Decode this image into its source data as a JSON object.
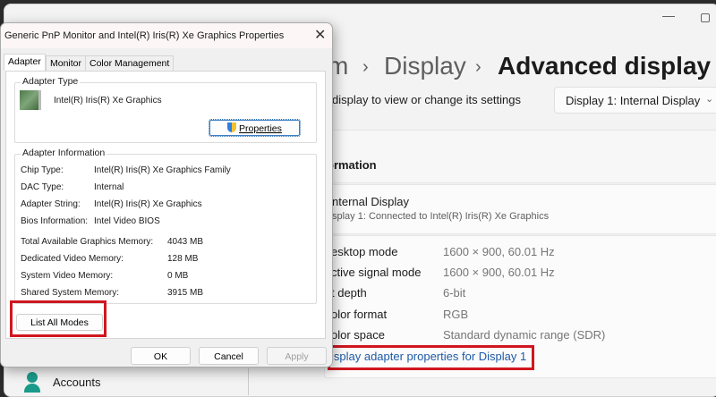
{
  "settings": {
    "breadcrumb": {
      "partial": "m",
      "display": "Display",
      "current": "Advanced display"
    },
    "select_prompt": "display to view or change its settings",
    "display_dropdown": "Display 1: Internal Display",
    "section_title": "ormation",
    "display_name": "nternal Display",
    "display_sub": "splay 1: Connected to Intel(R) Iris(R) Xe Graphics",
    "rows": [
      {
        "label": "esktop mode",
        "value": "1600 × 900, 60.01 Hz"
      },
      {
        "label": "ctive signal mode",
        "value": "1600 × 900, 60.01 Hz"
      },
      {
        "label": "t depth",
        "value": "6-bit"
      },
      {
        "label": "olor format",
        "value": "RGB"
      },
      {
        "label": "olor space",
        "value": "Standard dynamic range (SDR)"
      }
    ],
    "adapter_link": "isplay adapter properties for Display 1",
    "sidebar_accounts": "Accounts",
    "link_color": "#1f5aa6",
    "highlight_color": "#d0161f"
  },
  "dialog": {
    "title": "Generic PnP Monitor and Intel(R) Iris(R) Xe Graphics Properties",
    "tabs": [
      "Adapter",
      "Monitor",
      "Color Management"
    ],
    "adapter_type_label": "Adapter Type",
    "adapter_name": "Intel(R) Iris(R) Xe Graphics",
    "properties_button": "Properties",
    "adapter_info_label": "Adapter Information",
    "info": [
      {
        "label": "Chip Type:",
        "value": "Intel(R) Iris(R) Xe Graphics Family"
      },
      {
        "label": "DAC Type:",
        "value": "Internal"
      },
      {
        "label": "Adapter String:",
        "value": "Intel(R) Iris(R) Xe Graphics"
      },
      {
        "label": "Bios Information:",
        "value": "Intel Video BIOS"
      }
    ],
    "memory": [
      {
        "label": "Total Available Graphics Memory:",
        "value": "4043 MB"
      },
      {
        "label": "Dedicated Video Memory:",
        "value": "128 MB"
      },
      {
        "label": "System Video Memory:",
        "value": "0 MB"
      },
      {
        "label": "Shared System Memory:",
        "value": "3915 MB"
      }
    ],
    "list_modes_button": "List All Modes",
    "ok": "OK",
    "cancel": "Cancel",
    "apply": "Apply"
  }
}
